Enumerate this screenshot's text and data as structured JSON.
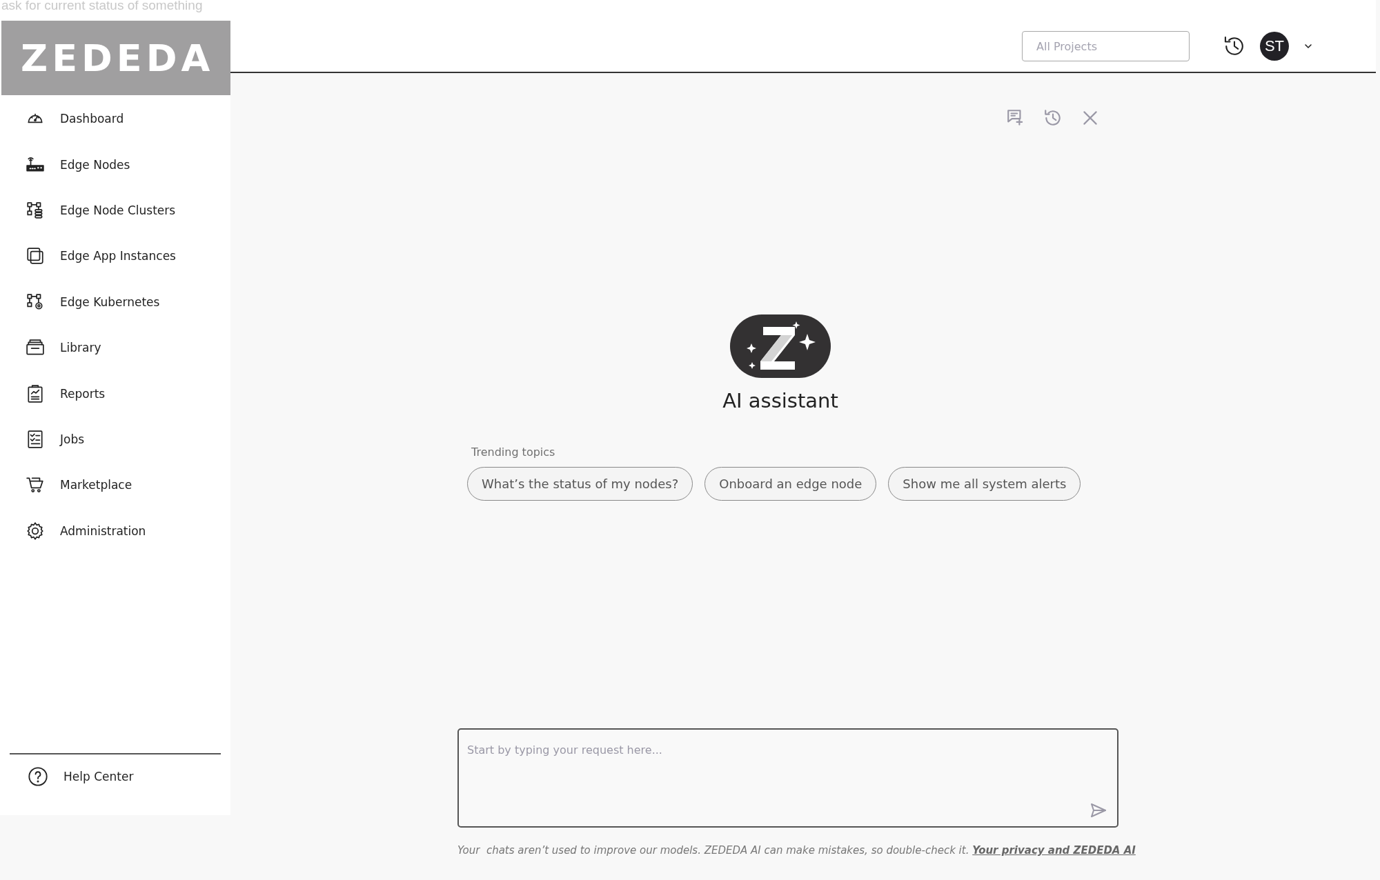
{
  "caption": "ask for current status of something",
  "logo": {
    "text": "ZEDEDA"
  },
  "sidebar": {
    "items": [
      {
        "label": "Dashboard",
        "selected": false
      },
      {
        "label": "Edge Nodes",
        "selected": false
      },
      {
        "label": "Edge Node Clusters",
        "selected": false
      },
      {
        "label": "Edge App Instances",
        "selected": false
      },
      {
        "label": "Edge Kubernetes",
        "selected": false
      },
      {
        "label": "Library",
        "selected": false
      },
      {
        "label": "Reports",
        "selected": false
      },
      {
        "label": "Jobs",
        "selected": false
      },
      {
        "label": "Marketplace",
        "selected": false
      },
      {
        "label": "Administration",
        "selected": false
      }
    ],
    "footer": {
      "label": "Help Center"
    }
  },
  "topbar": {
    "project_field": {
      "placeholder": "All Projects"
    },
    "avatar": "ST"
  },
  "assistant": {
    "title": "AI assistant",
    "trending_label": "Trending topics",
    "topics": [
      "What’s the status of my nodes?",
      "Onboard an edge node",
      "Show me all system alerts"
    ],
    "input": {
      "placeholder": "Start by typing your request here..."
    },
    "disclaimer": "Your  chats aren’t used to improve our models. ZEDEDA AI can make mistakes, so double-check it.",
    "privacy_link": "Your privacy and ZEDEDA AI"
  }
}
